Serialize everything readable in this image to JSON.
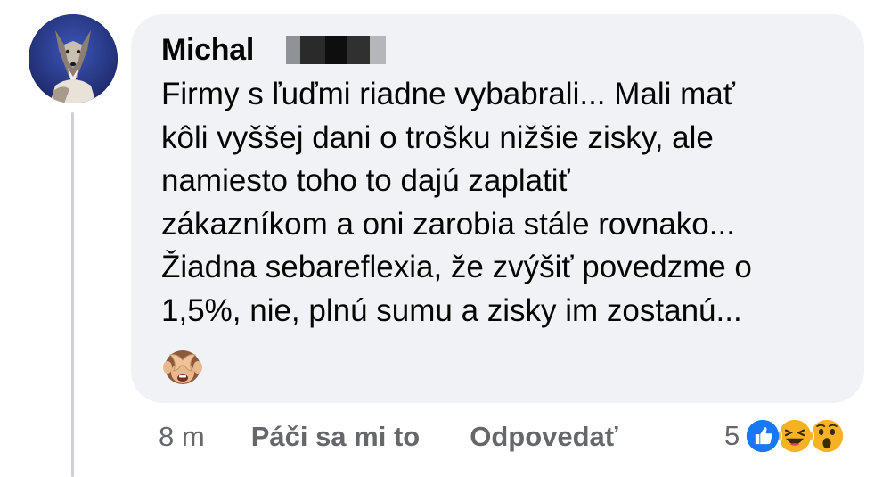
{
  "comment": {
    "author": "Michal",
    "text": "Firmy s ľuďmi riadne vybabrali... Mali mať\nkôli vyššej dani o trošku nižšie zisky, ale\nnamiesto toho to dajú zaplatiť\nzákazníkom a oni zarobia stále rovnako...\nŽiadna sebareflexia, že zvýšiť povedzme o\n1,5%, nie, plnú sumu a zisky im zostanú...",
    "trailing_emoji": "see-no-evil-monkey-emoji"
  },
  "actions": {
    "timestamp": "8 m",
    "like_label": "Páči sa mi to",
    "reply_label": "Odpovedať"
  },
  "reactions": {
    "count": "5",
    "icons": [
      "like-reaction-icon",
      "haha-reaction-icon",
      "wow-reaction-icon"
    ]
  },
  "colors": {
    "bubble_bg": "#f0f2f5",
    "text": "#050505",
    "secondary_text": "#65676b",
    "like_blue": "#1877f2",
    "emoji_yellow": "#f7b125"
  }
}
